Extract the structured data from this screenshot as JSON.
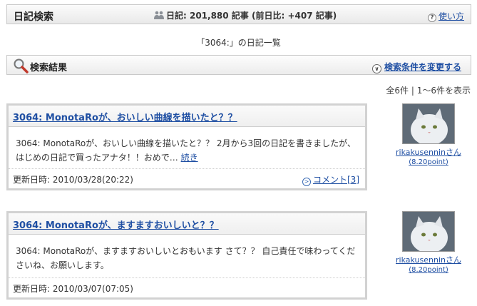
{
  "header": {
    "title": "日記検索",
    "stats": "日記: 201,880 記事 (前日比: +407 記事)",
    "help_label": "使い方"
  },
  "list_title": "「3064:」の日記一覧",
  "results": {
    "label": "検索結果",
    "change_label": "検索条件を変更する",
    "count": "全6件 | 1〜6件を表示"
  },
  "entries": [
    {
      "title": "3064: MonotaRoが、おいしい曲線を描いたと？？",
      "excerpt": "3064: MonotaRoが、おいしい曲線を描いたと？？ 2月から3回の日記を書きましたが、はじめの日記で買ったアナタ！！おめで…",
      "more_label": "続き",
      "date": "更新日時: 2010/03/28(20:22)",
      "comment_label": "コメント[3]",
      "user": {
        "name": "rikakusenninさん",
        "points": "(8.20point)"
      }
    },
    {
      "title": "3064: MonotaRoが、ますますおいしいと？？",
      "excerpt": "3064: MonotaRoが、ますますおいしいとおもいます さて？？ 自己責任で味わってくださいね、お願いします。",
      "date": "更新日時: 2010/03/07(07:05)",
      "user": {
        "name": "rikakusenninさん",
        "points": "(8.20point)"
      }
    }
  ]
}
